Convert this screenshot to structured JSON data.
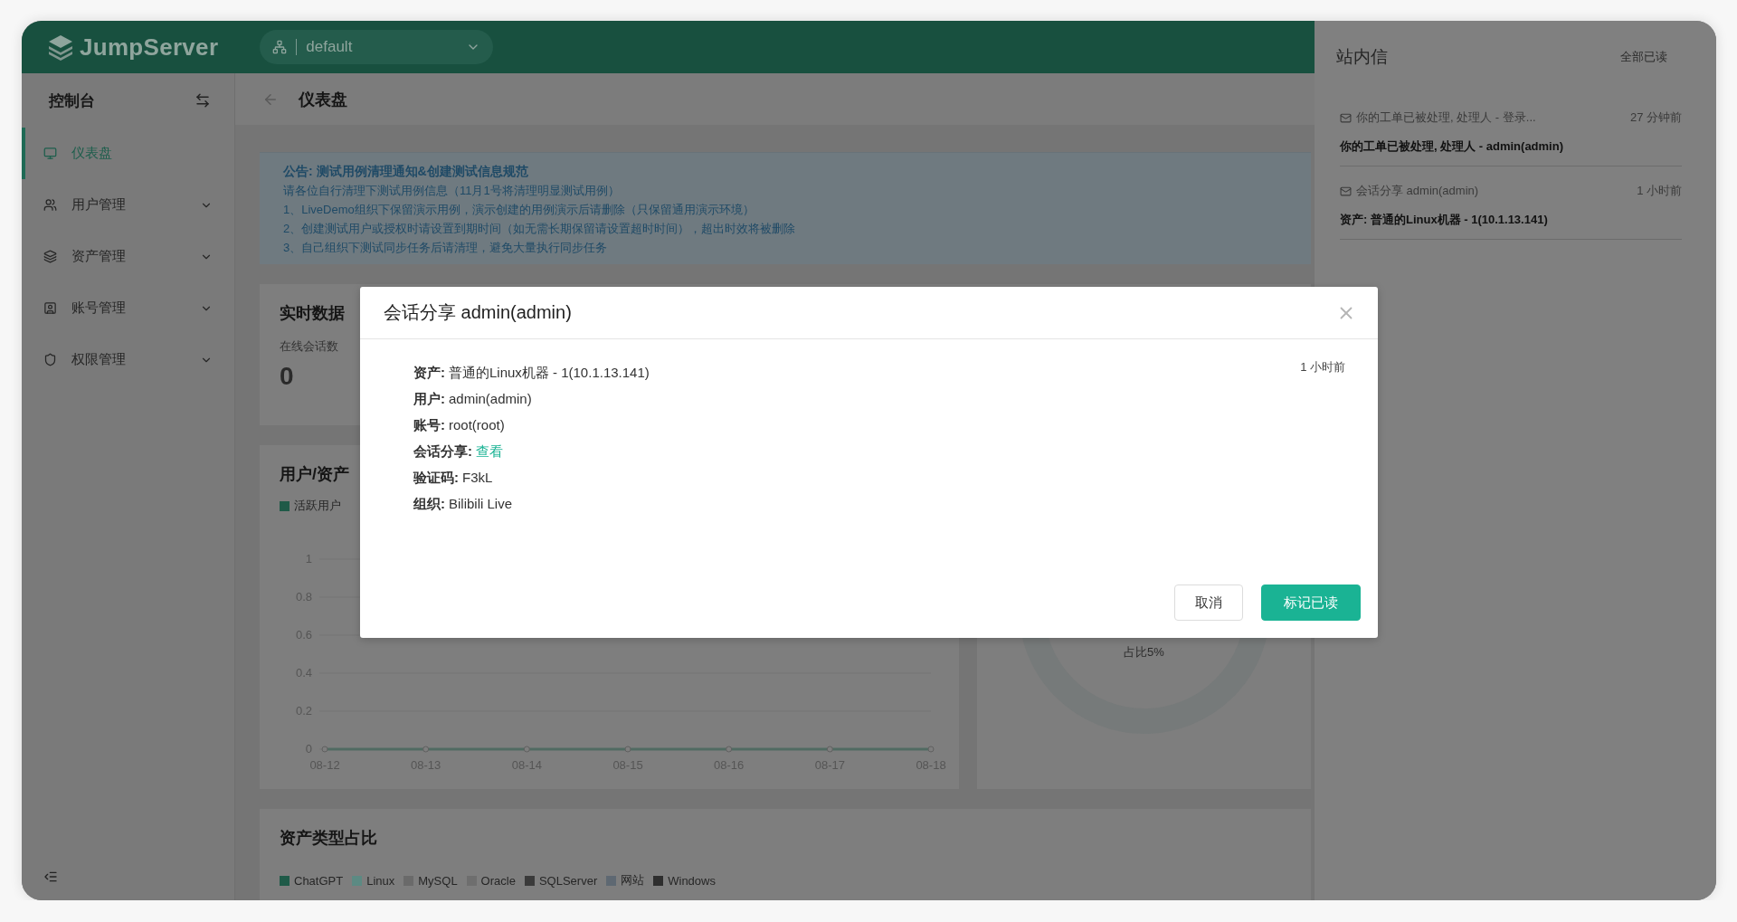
{
  "header": {
    "logo": "JumpServer",
    "org_selector": {
      "value": "default"
    }
  },
  "sidebar": {
    "title": "控制台",
    "items": [
      {
        "label": "仪表盘",
        "kind": "link",
        "selected": true
      },
      {
        "label": "用户管理",
        "kind": "group",
        "selected": false
      },
      {
        "label": "资产管理",
        "kind": "group",
        "selected": false
      },
      {
        "label": "账号管理",
        "kind": "group",
        "selected": false
      },
      {
        "label": "权限管理",
        "kind": "group",
        "selected": false
      }
    ]
  },
  "breadcrumb": {
    "title": "仪表盘"
  },
  "announcement": {
    "title": "公告: 测试用例清理通知&创建测试信息规范",
    "lines": [
      "请各位自行清理下测试用例信息（11月1号将清理明显测试用例）",
      "1、LiveDemo组织下保留演示用例，演示创建的用例演示后请删除（只保留通用演示环境）",
      "2、创建测试用户或授权时请设置到期时间（如无需长期保留请设置超时时间），超出时效将被删除",
      "3、自己组织下测试同步任务后请清理，避免大量执行同步任务"
    ]
  },
  "realtime": {
    "title": "实时数据",
    "metric_label": "在线会话数",
    "metric_value": "0"
  },
  "trend": {
    "title": "用户/资产",
    "chart_data": {
      "type": "line",
      "categories": [
        "08-12",
        "08-13",
        "08-14",
        "08-15",
        "08-16",
        "08-17",
        "08-18"
      ],
      "ylim": [
        0,
        1
      ],
      "yticks": [
        0,
        0.2,
        0.4,
        0.6,
        0.8,
        1
      ],
      "series": [
        {
          "name": "活跃用户",
          "color": "#1f5a48",
          "marker": "circle",
          "values": [
            0,
            0,
            0,
            0,
            0,
            0,
            0
          ]
        }
      ]
    }
  },
  "ratio": {
    "center_label": "占比5%"
  },
  "asset_types": {
    "title": "资产类型占比",
    "legend": [
      {
        "label": "ChatGPT",
        "color": "#1f5a48"
      },
      {
        "label": "Linux",
        "color": "#5c8a83"
      },
      {
        "label": "MySQL",
        "color": "#6a6a6a"
      },
      {
        "label": "Oracle",
        "color": "#6e6e6e"
      },
      {
        "label": "SQLServer",
        "color": "#3a3a3a"
      },
      {
        "label": "网站",
        "color": "#5e6872"
      },
      {
        "label": "Windows",
        "color": "#2e2e2e"
      }
    ]
  },
  "drawer": {
    "title": "站内信",
    "mark_all": "全部已读",
    "messages": [
      {
        "subject": "你的工单已被处理, 处理人 - 登录...",
        "time": "27 分钟前",
        "content": "你的工单已被处理, 处理人 - admin(admin)"
      },
      {
        "subject": "会话分享 admin(admin)",
        "time": "1 小时前",
        "content": "资产: 普通的Linux机器 - 1(10.1.13.141)"
      }
    ]
  },
  "modal": {
    "title": "会话分享 admin(admin)",
    "time": "1 小时前",
    "fields": [
      {
        "label": "资产:",
        "value": "普通的Linux机器 - 1(10.1.13.141)",
        "kind": "text"
      },
      {
        "label": "用户:",
        "value": "admin(admin)",
        "kind": "text"
      },
      {
        "label": "账号:",
        "value": "root(root)",
        "kind": "text"
      },
      {
        "label": "会话分享:",
        "value": "查看",
        "kind": "link"
      },
      {
        "label": "验证码:",
        "value": "F3kL",
        "kind": "text"
      },
      {
        "label": "组织:",
        "value": "Bilibili Live",
        "kind": "text"
      }
    ],
    "buttons": [
      {
        "label": "取消",
        "kind": "secondary"
      },
      {
        "label": "标记已读",
        "kind": "primary"
      }
    ]
  }
}
